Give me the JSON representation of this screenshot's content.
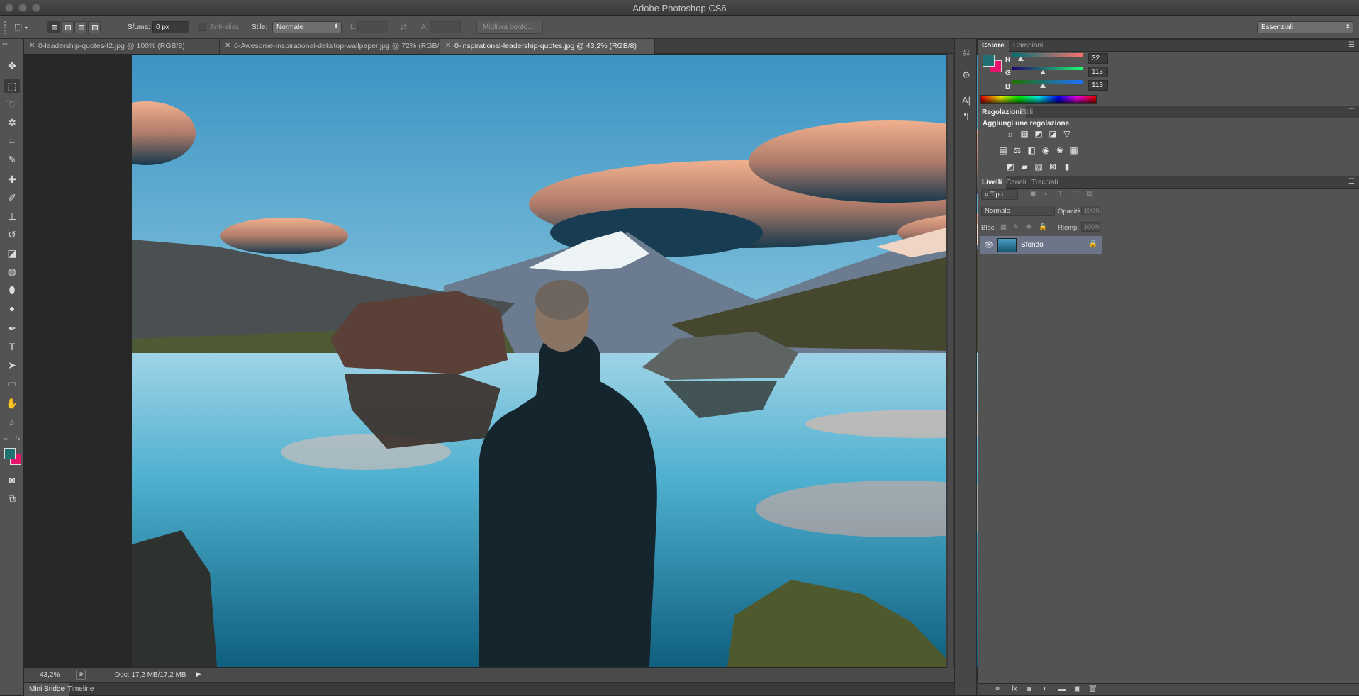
{
  "window": {
    "title": "Adobe Photoshop CS6"
  },
  "options_bar": {
    "feather_label": "Sfuma:",
    "feather_value": "0 px",
    "antialias_label": "Anti-alias",
    "style_label": "Stile:",
    "style_value": "Normale",
    "width_label": "L:",
    "height_label": "A:",
    "refine_edge_label": "Migliora bordo...",
    "workspace_value": "Essenziali"
  },
  "document_tabs": [
    {
      "label": "0-leadership-quotes-t2.jpg @ 100% (RGB/8)",
      "active": false
    },
    {
      "label": "0-Awesome-inspirational-dekstop-wallpaper.jpg @ 72% (RGB/8)",
      "active": false
    },
    {
      "label": "0-inspirational-leadership-quotes.jpg @ 43,2% (RGB/8)",
      "active": true
    }
  ],
  "status_bar": {
    "zoom": "43,2%",
    "doc_size": "Doc: 17,2 MB/17,2 MB"
  },
  "bottom_tabs": [
    "Mini Bridge",
    "Timeline"
  ],
  "color_panel": {
    "tabs": [
      "Colore",
      "Campioni"
    ],
    "r_label": "R",
    "r_value": "32",
    "g_label": "G",
    "g_value": "113",
    "b_label": "B",
    "b_value": "113",
    "fg_color": "#207171",
    "bg_color": "#e8136a"
  },
  "adjustments_panel": {
    "tabs": [
      "Regolazioni",
      "Stili"
    ],
    "heading": "Aggiungi una regolazione"
  },
  "layers_panel": {
    "tabs": [
      "Livelli",
      "Canali",
      "Tracciati"
    ],
    "filter_value": "Tipo",
    "blend_mode": "Normale",
    "opacity_label": "Opacità:",
    "opacity_value": "100%",
    "lock_label": "Bloc.:",
    "fill_label": "Riemp.:",
    "fill_value": "100%",
    "layers": [
      {
        "name": "Sfondo",
        "visible": true,
        "locked": true
      }
    ]
  }
}
